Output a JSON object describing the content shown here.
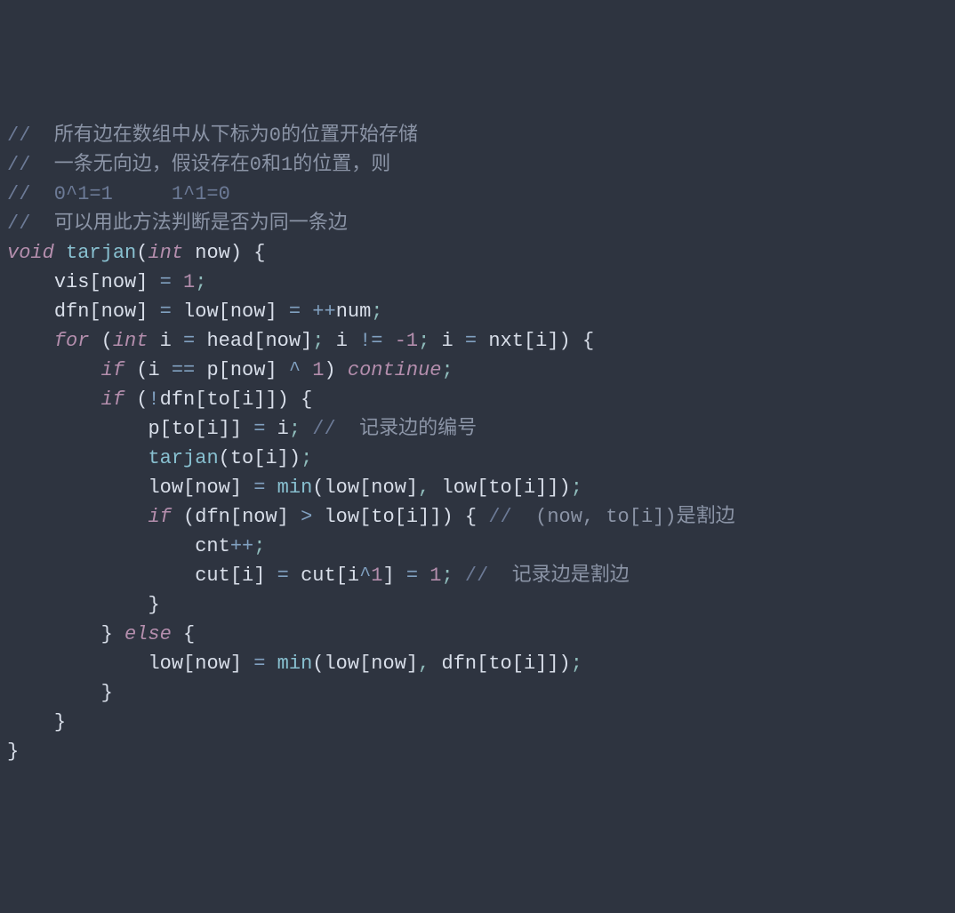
{
  "code": {
    "c1_slash": "// ",
    "c1_text": " 所有边在数组中从下标为0的位置开始存储",
    "c2_slash": "// ",
    "c2_text": " 一条无向边，假设存在0和1的位置，则",
    "c3": "//  0^1=1     1^1=0",
    "c4_slash": "// ",
    "c4_text": " 可以用此方法判断是否为同一条边",
    "l5_void": "void",
    "l5_fn": "tarjan",
    "l5_int": "int",
    "l5_arg": "now",
    "l6_vis": "vis",
    "l6_now": "now",
    "l7_dfn": "dfn",
    "l7_now1": "now",
    "l7_low": "low",
    "l7_now2": "now",
    "l7_num": "num",
    "l8_for": "for",
    "l8_int": "int",
    "l8_i": "i",
    "l8_head": "head",
    "l8_now": "now",
    "l8_i2": "i",
    "l8_neg1": "-1",
    "l8_i3": "i",
    "l8_nxt": "nxt",
    "l8_i4": "i",
    "l9_if": "if",
    "l9_i": "i",
    "l9_p": "p",
    "l9_now": "now",
    "l9_one": "1",
    "l9_cont": "continue",
    "l10_if": "if",
    "l10_dfn": "dfn",
    "l10_to": "to",
    "l10_i": "i",
    "l11_p": "p",
    "l11_to": "to",
    "l11_i": "i",
    "l11_i2": "i",
    "l11_c_slash": "// ",
    "l11_c_text": " 记录边的编号",
    "l12_tarjan": "tarjan",
    "l12_to": "to",
    "l12_i": "i",
    "l13_low": "low",
    "l13_now": "now",
    "l13_min": "min",
    "l13_low2": "low",
    "l13_now2": "now",
    "l13_low3": "low",
    "l13_to": "to",
    "l13_i": "i",
    "l14_if": "if",
    "l14_dfn": "dfn",
    "l14_now": "now",
    "l14_low": "low",
    "l14_to": "to",
    "l14_i": "i",
    "l14_c_slash": "// ",
    "l14_c_text": " (now, to[i])是割边",
    "l15_cnt": "cnt",
    "l16_cut": "cut",
    "l16_i": "i",
    "l16_cut2": "cut",
    "l16_i2": "i",
    "l16_one": "1",
    "l16_one2": "1",
    "l16_c_slash": "// ",
    "l16_c_text": " 记录边是割边",
    "l18_else": "else",
    "l19_low": "low",
    "l19_now": "now",
    "l19_min": "min",
    "l19_low2": "low",
    "l19_now2": "now",
    "l19_dfn": "dfn",
    "l19_to": "to",
    "l19_i": "i"
  }
}
